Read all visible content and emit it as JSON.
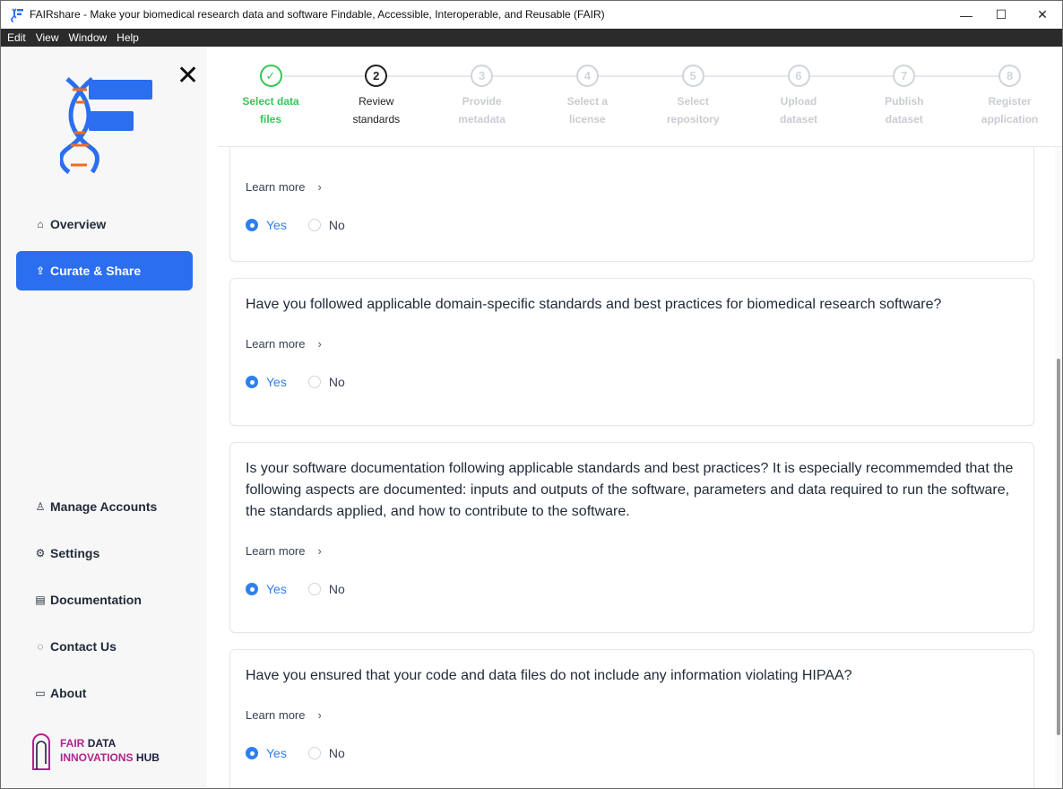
{
  "window": {
    "title": "FAIRshare - Make your biomedical research data and software Findable, Accessible, Interoperable, and Reusable (FAIR)",
    "minimize": "—",
    "maximize": "☐",
    "close": "✕"
  },
  "menu": [
    "Edit",
    "View",
    "Window",
    "Help"
  ],
  "sidebar": {
    "close_symbol": "✕",
    "top_items": [
      {
        "label": "Overview",
        "icon": "home-icon",
        "glyph": "⌂"
      },
      {
        "label": "Curate & Share",
        "icon": "share-icon",
        "glyph": "⇪",
        "active": true
      }
    ],
    "bottom_items": [
      {
        "label": "Manage Accounts",
        "icon": "user-icon",
        "glyph": "♙"
      },
      {
        "label": "Settings",
        "icon": "gear-icon",
        "glyph": "⚙"
      },
      {
        "label": "Documentation",
        "icon": "book-icon",
        "glyph": "▤"
      },
      {
        "label": "Contact Us",
        "icon": "chat-icon",
        "glyph": "◌"
      },
      {
        "label": "About",
        "icon": "info-card-icon",
        "glyph": "▭"
      }
    ],
    "hub": {
      "line1a": "FAIR",
      "line1b": "DATA",
      "line2a": "INNOVATIONS",
      "line2b": "HUB"
    }
  },
  "stepper": {
    "steps": [
      {
        "num": "✓",
        "line1": "Select data",
        "line2": "files",
        "state": "done"
      },
      {
        "num": "2",
        "line1": "Review",
        "line2": "standards",
        "state": "current"
      },
      {
        "num": "3",
        "line1": "Provide",
        "line2": "metadata",
        "state": "todo"
      },
      {
        "num": "4",
        "line1": "Select a",
        "line2": "license",
        "state": "todo"
      },
      {
        "num": "5",
        "line1": "Select",
        "line2": "repository",
        "state": "todo"
      },
      {
        "num": "6",
        "line1": "Upload",
        "line2": "dataset",
        "state": "todo"
      },
      {
        "num": "7",
        "line1": "Publish",
        "line2": "dataset",
        "state": "todo"
      },
      {
        "num": "8",
        "line1": "Register",
        "line2": "application",
        "state": "todo"
      }
    ]
  },
  "common": {
    "learn_more": "Learn more",
    "yes": "Yes",
    "no": "No"
  },
  "questions": [
    {
      "text": "",
      "answer": "Yes"
    },
    {
      "text": "Have you followed applicable domain-specific standards and best practices for biomedical research software?",
      "answer": "Yes"
    },
    {
      "text": "Is your software documentation following applicable standards and best practices? It is especially recommemded that the following aspects are documented: inputs and outputs of the software, parameters and data required to run the software, the standards applied, and how to contribute to the software.",
      "answer": "Yes"
    },
    {
      "text": "Have you ensured that your code and data files do not include any information violating HIPAA?",
      "answer": "Yes"
    }
  ],
  "colors": {
    "accent": "#2b6ef0",
    "done": "#34c759",
    "radio": "#2f80ed",
    "menubar": "#2b2b2b"
  }
}
